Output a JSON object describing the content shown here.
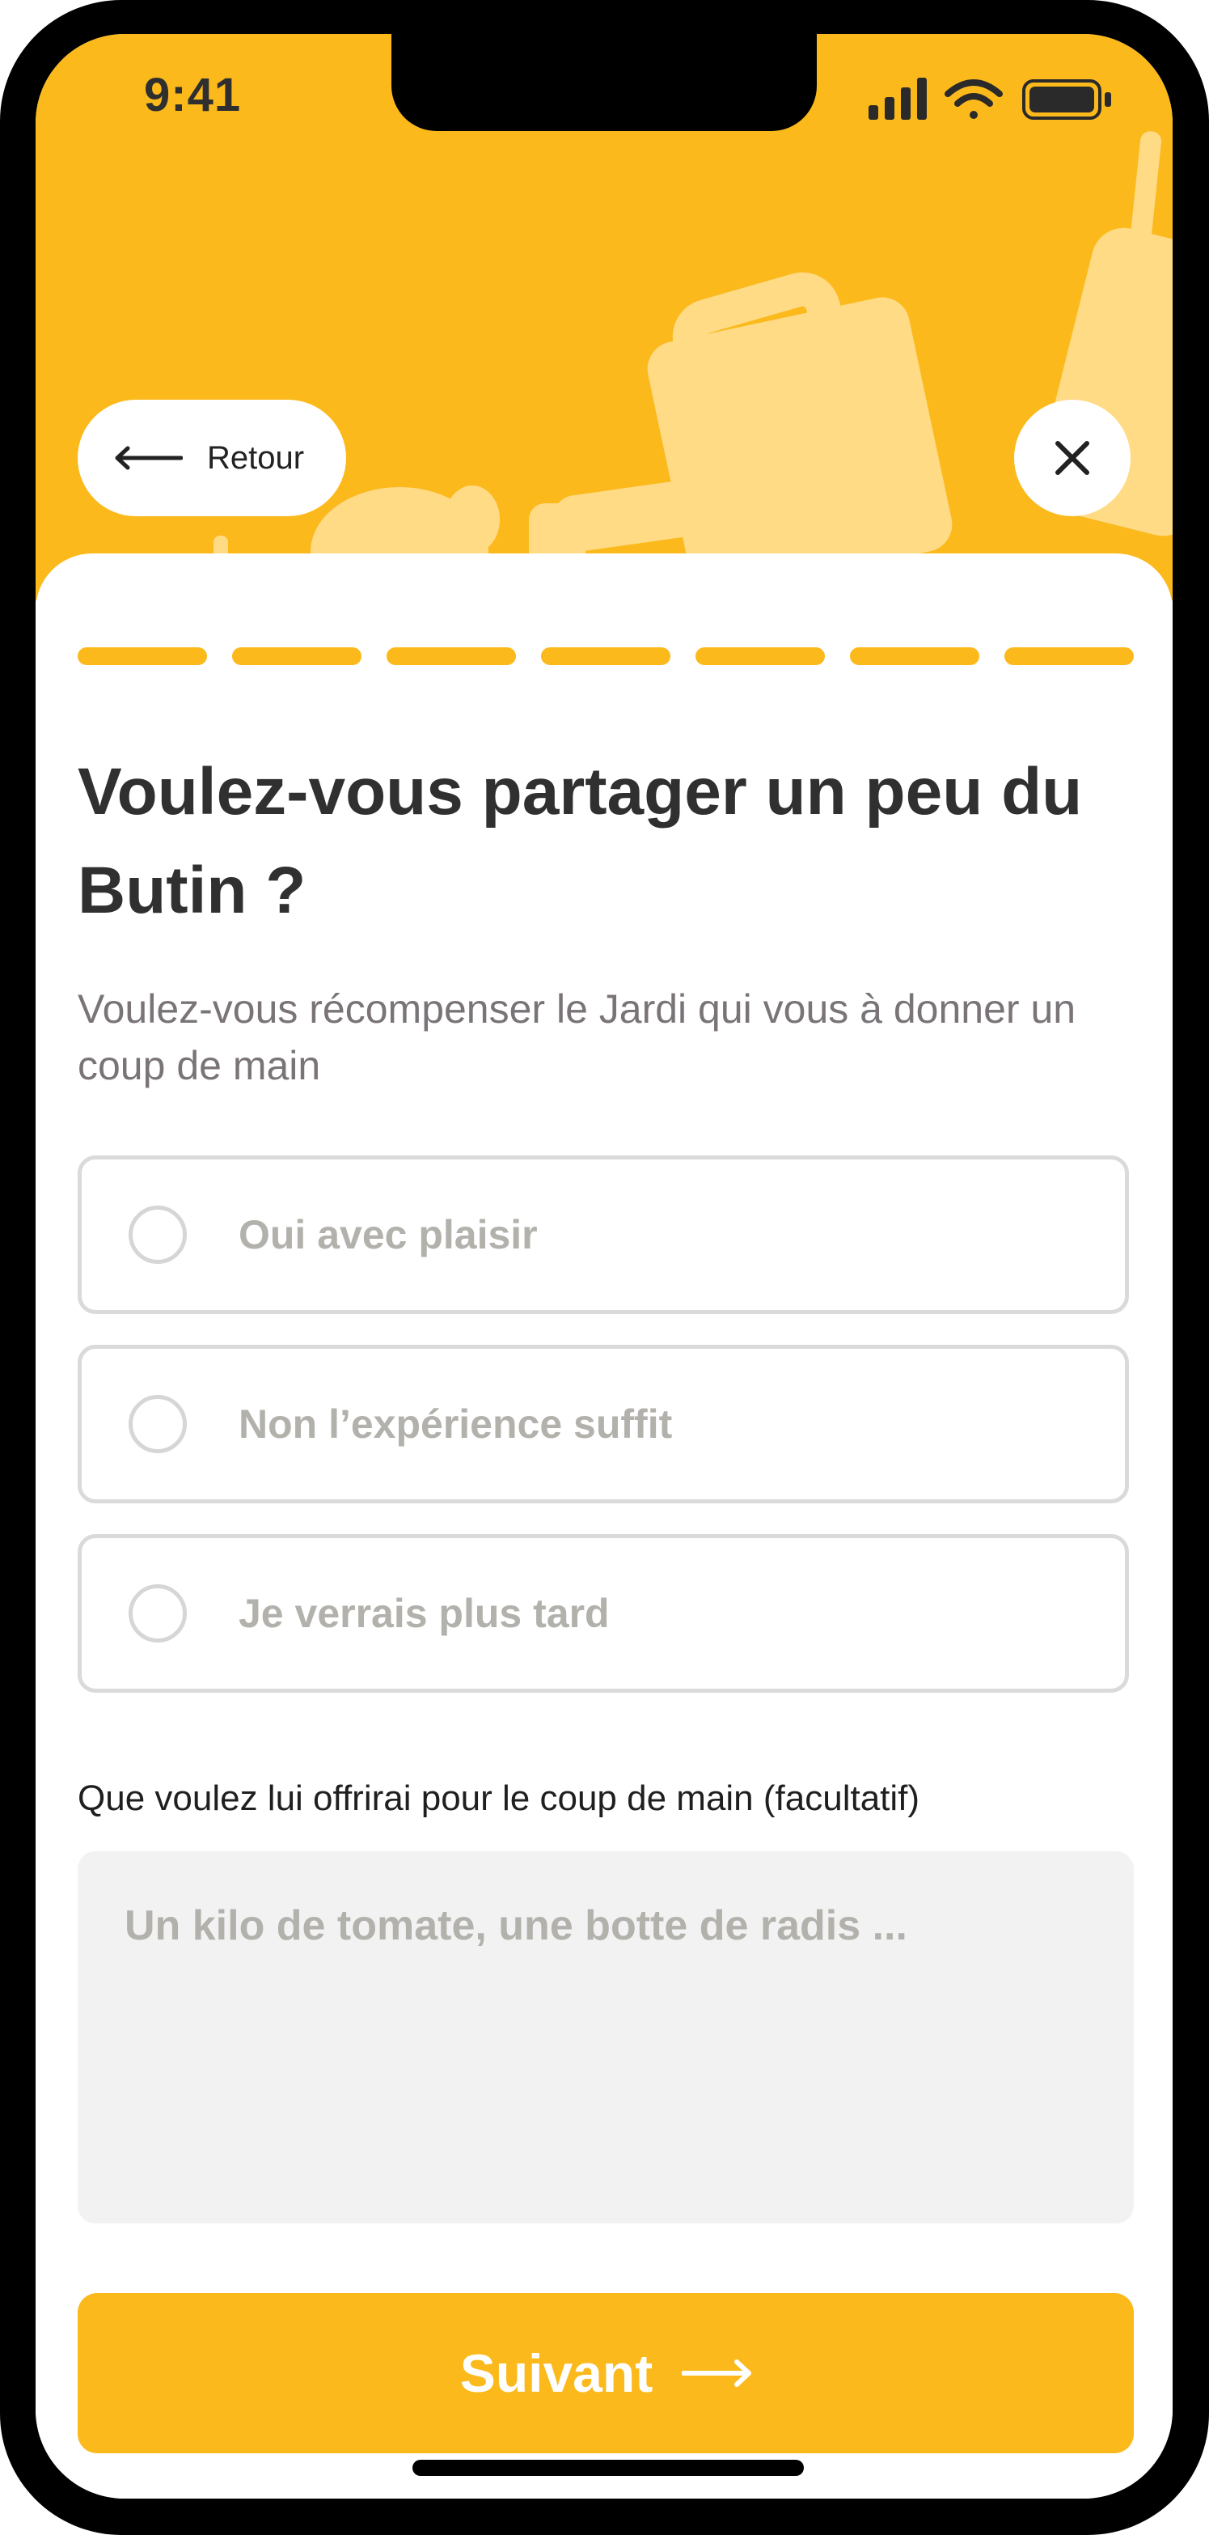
{
  "colors": {
    "accent": "#FBB91C",
    "title": "#303030",
    "muted": "#b3b1ac",
    "frame": "#000000"
  },
  "status_bar": {
    "time": "9:41",
    "icons": [
      "signal-icon",
      "wifi-icon",
      "battery-icon"
    ]
  },
  "nav": {
    "back_label": "Retour",
    "back_icon": "arrow-left-icon",
    "close_icon": "close-icon"
  },
  "progress": {
    "steps_total": 7,
    "steps_completed": 7
  },
  "question": {
    "title": "Voulez-vous partager un peu du Butin ?",
    "subtitle": "Voulez-vous récompenser le Jardi qui vous à donner un coup de main"
  },
  "options": [
    {
      "label": "Oui avec plaisir",
      "selected": false
    },
    {
      "label": "Non l’expérience suffit",
      "selected": false
    },
    {
      "label": "Je verrais plus tard",
      "selected": false
    }
  ],
  "gift_field": {
    "label": "Que voulez lui offrirai pour le coup de main (facultatif)",
    "placeholder": "Un kilo de tomate, une botte de radis ...",
    "value": ""
  },
  "next_button": {
    "label": "Suivant",
    "icon": "arrow-right-icon"
  }
}
